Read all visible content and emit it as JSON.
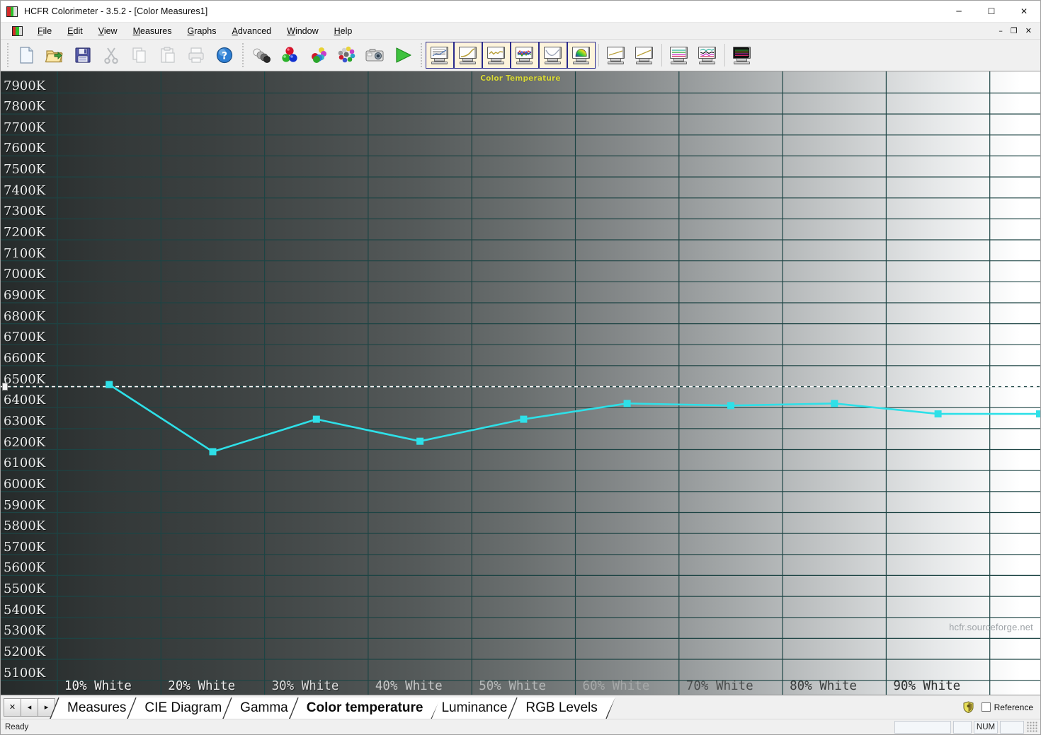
{
  "window": {
    "title": "HCFR Colorimeter - 3.5.2 - [Color Measures1]",
    "minimize_label": "─",
    "maximize_label": "☐",
    "close_label": "✕"
  },
  "mdi_controls": {
    "minimize_label": "–",
    "restore_label": "❐",
    "close_label": "✕"
  },
  "menu": {
    "items": [
      {
        "label": "File",
        "accel": "F"
      },
      {
        "label": "Edit",
        "accel": "E"
      },
      {
        "label": "View",
        "accel": "V"
      },
      {
        "label": "Measures",
        "accel": "M"
      },
      {
        "label": "Graphs",
        "accel": "G"
      },
      {
        "label": "Advanced",
        "accel": "A"
      },
      {
        "label": "Window",
        "accel": "W"
      },
      {
        "label": "Help",
        "accel": "H"
      }
    ]
  },
  "toolbar": {
    "groups": [
      {
        "name": "file-group",
        "buttons": [
          {
            "icon": "new-document-icon",
            "label": "New",
            "enabled": true
          },
          {
            "icon": "open-folder-icon",
            "label": "Open",
            "enabled": true
          },
          {
            "icon": "save-disk-icon",
            "label": "Save",
            "enabled": true
          },
          {
            "icon": "cut-scissors-icon",
            "label": "Cut",
            "enabled": false
          },
          {
            "icon": "copy-icon",
            "label": "Copy",
            "enabled": false
          },
          {
            "icon": "paste-icon",
            "label": "Paste",
            "enabled": false
          },
          {
            "icon": "print-icon",
            "label": "Print",
            "enabled": false
          },
          {
            "icon": "help-question-icon",
            "label": "About",
            "enabled": true
          }
        ]
      },
      {
        "name": "measure-group",
        "buttons": [
          {
            "icon": "grayscale-spheres-icon",
            "label": "Grayscale measures",
            "enabled": true
          },
          {
            "icon": "primaries-spheres-icon",
            "label": "Primary colors",
            "enabled": true
          },
          {
            "icon": "secondaries-spheres-icon",
            "label": "Secondary colors",
            "enabled": true
          },
          {
            "icon": "full-colors-spheres-icon",
            "label": "All colors",
            "enabled": true
          },
          {
            "icon": "camera-icon",
            "label": "Capture",
            "enabled": true
          },
          {
            "icon": "play-triangle-icon",
            "label": "Run measures",
            "enabled": true
          }
        ]
      },
      {
        "name": "view-group",
        "buttons": [
          {
            "icon": "monitor-measures-icon",
            "label": "Measures",
            "selected": true
          },
          {
            "icon": "monitor-gamma-icon",
            "label": "Gamma",
            "selected": true
          },
          {
            "icon": "monitor-colortemp-icon",
            "label": "Color temperature",
            "selected": true
          },
          {
            "icon": "monitor-rgblevels-icon",
            "label": "RGB levels",
            "selected": true
          },
          {
            "icon": "monitor-luminance-icon",
            "label": "Luminance",
            "selected": true
          },
          {
            "icon": "monitor-cie-icon",
            "label": "CIE diagram",
            "selected": true
          }
        ]
      },
      {
        "name": "extra-group",
        "buttons": [
          {
            "icon": "monitor-plain-a-icon",
            "label": "Graph A",
            "selected": false
          },
          {
            "icon": "monitor-plain-b-icon",
            "label": "Graph B",
            "selected": false
          },
          {
            "icon": "monitor-rgb-lines-icon",
            "label": "RGB lines",
            "selected": false
          },
          {
            "icon": "monitor-rgb-noise-icon",
            "label": "RGB noise",
            "selected": false
          },
          {
            "icon": "monitor-dark-rgb-icon",
            "label": "Dark RGB",
            "selected": false
          }
        ]
      }
    ]
  },
  "chart_data": {
    "type": "line",
    "title": "Color Temperature",
    "xlabel": "",
    "ylabel": "",
    "grid": true,
    "legend": "none",
    "categories": [
      "10% White",
      "20% White",
      "30% White",
      "40% White",
      "50% White",
      "60% White",
      "70% White",
      "80% White",
      "90% White"
    ],
    "x_tick_labels": [
      "10% White",
      "20% White",
      "30% White",
      "40% White",
      "50% White",
      "60% White",
      "70% White",
      "80% White",
      "90% White"
    ],
    "y_tick_labels": [
      "7900K",
      "7800K",
      "7700K",
      "7600K",
      "7500K",
      "7400K",
      "7300K",
      "7200K",
      "7100K",
      "7000K",
      "6900K",
      "6800K",
      "6700K",
      "6600K",
      "6500K",
      "6400K",
      "6300K",
      "6200K",
      "6100K",
      "6000K",
      "5900K",
      "5800K",
      "5700K",
      "5600K",
      "5500K",
      "5400K",
      "5300K",
      "5200K",
      "5100K"
    ],
    "ylim": [
      5050,
      7950
    ],
    "y_unit": "K",
    "series": [
      {
        "name": "Color temperature",
        "color": "#2ee0e8",
        "marker": "square",
        "values": [
          6510,
          6190,
          6345,
          6240,
          6345,
          6420,
          6410,
          6420,
          6370
        ]
      }
    ],
    "reference_line": {
      "name": "Reference 6500K",
      "value": 6500,
      "style": "dashed",
      "color": "#ffffff"
    },
    "annotations": [
      {
        "name": "watermark",
        "text": "hcfr.sourceforge.net"
      }
    ]
  },
  "tab_strip": {
    "nav": {
      "close_label": "✕",
      "prev_label": "◂",
      "next_label": "▸"
    },
    "tabs": [
      {
        "label": "Measures",
        "active": false
      },
      {
        "label": "CIE Diagram",
        "active": false
      },
      {
        "label": "Gamma",
        "active": false
      },
      {
        "label": "Color temperature",
        "active": true
      },
      {
        "label": "Luminance",
        "active": false
      },
      {
        "label": "RGB Levels",
        "active": false
      }
    ],
    "shield_icon": "shield-icon",
    "reference_checkbox": {
      "label": "Reference",
      "checked": false
    }
  },
  "status_bar": {
    "text": "Ready",
    "panes": [
      "",
      "",
      "NUM",
      ""
    ]
  }
}
